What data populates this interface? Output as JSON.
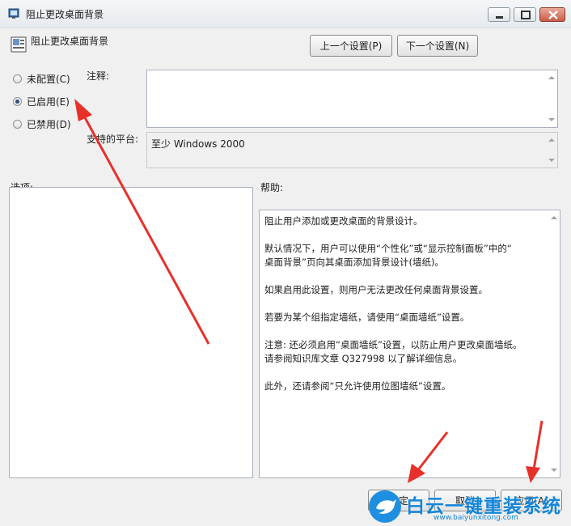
{
  "window": {
    "title": "阻止更改桌面背景"
  },
  "header": {
    "setting_name": "阻止更改桌面背景"
  },
  "nav": {
    "prev_label": "上一个设置(P)",
    "next_label": "下一个设置(N)"
  },
  "state": {
    "options": [
      {
        "label": "未配置(C)",
        "checked": false
      },
      {
        "label": "已启用(E)",
        "checked": true
      },
      {
        "label": "已禁用(D)",
        "checked": false
      }
    ]
  },
  "comment": {
    "label": "注释:",
    "value": ""
  },
  "platform": {
    "label": "支持的平台:",
    "value": "至少 Windows 2000"
  },
  "options_panel": {
    "label": "选项:"
  },
  "help": {
    "label": "帮助:",
    "paragraphs": [
      "阻止用户添加或更改桌面的背景设计。",
      "默认情况下，用户可以使用“个性化”或“显示控制面板”中的“\n桌面背景”页向其桌面添加背景设计(墙纸)。",
      "如果启用此设置，则用户无法更改任何桌面背景设置。",
      "若要为某个组指定墙纸，请使用“桌面墙纸”设置。",
      "注意: 还必须启用“桌面墙纸”设置，以防止用户更改桌面墙纸。\n请参阅知识库文章 Q327998 以了解详细信息。",
      "此外，还请参阅“只允许使用位图墙纸”设置。"
    ]
  },
  "footer": {
    "ok_label": "确定",
    "cancel_label": "取消",
    "apply_label": "应用(A)"
  },
  "watermark": {
    "title": "白云一键重装系统",
    "url": "www.baiyunxitong.com"
  },
  "colors": {
    "annotation_arrow": "#e8302a",
    "watermark_blue": "#1485d8"
  },
  "icons": {
    "app": "policy-setting-icon",
    "watermark_logo": "bird-logo-icon"
  }
}
